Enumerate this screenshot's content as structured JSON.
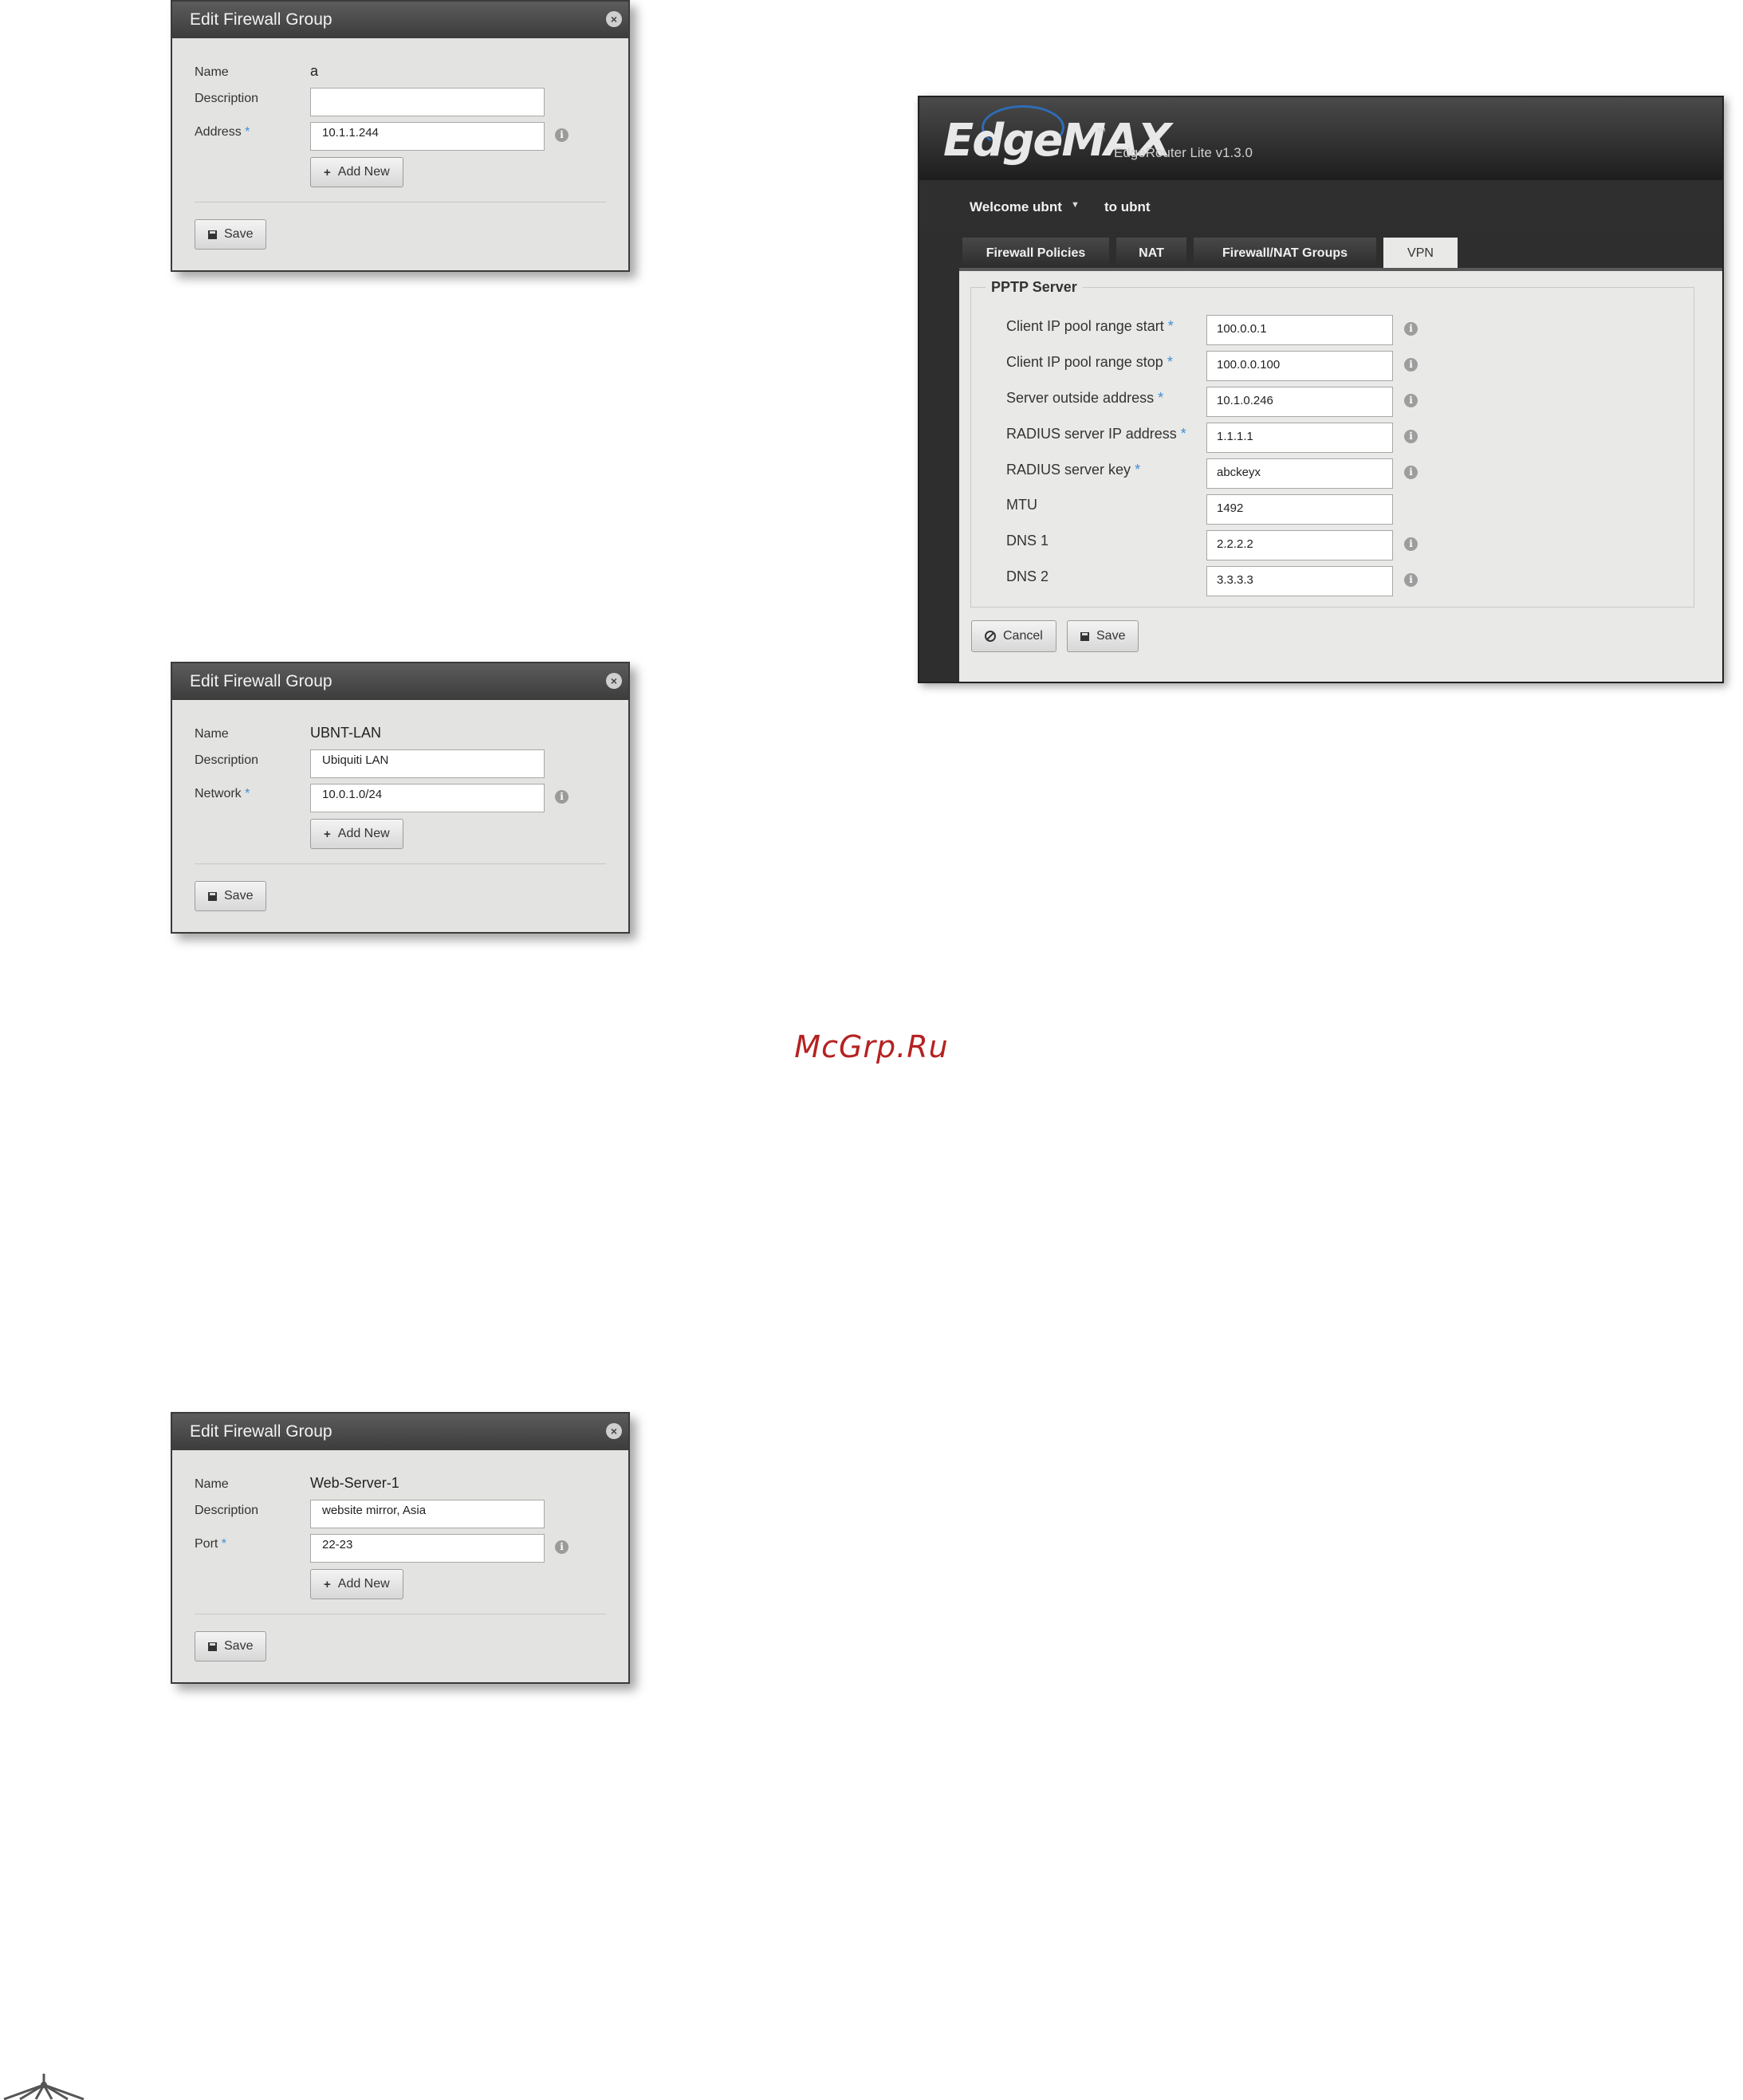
{
  "dialogs": [
    {
      "title": "Edit Firewall Group",
      "name_label": "Name",
      "name_value": "a",
      "description_label": "Description",
      "description_value": "",
      "field_label": "Address",
      "field_value": "10.1.1.244",
      "add_new_label": "Add New",
      "save_label": "Save"
    },
    {
      "title": "Edit Firewall Group",
      "name_label": "Name",
      "name_value": "UBNT-LAN",
      "description_label": "Description",
      "description_value": "Ubiquiti LAN",
      "field_label": "Network",
      "field_value": "10.0.1.0/24",
      "add_new_label": "Add New",
      "save_label": "Save"
    },
    {
      "title": "Edit Firewall Group",
      "name_label": "Name",
      "name_value": "Web-Server-1",
      "description_label": "Description",
      "description_value": "website mirror, Asia",
      "field_label": "Port",
      "field_value": "22-23",
      "add_new_label": "Add New",
      "save_label": "Save"
    }
  ],
  "required_marker": "*",
  "edgemax": {
    "logo": "EdgeMAX",
    "trademark": "™",
    "model": "EdgeRouter Lite v1.3.0",
    "welcome": "Welcome ubnt",
    "to_user": "to ubnt",
    "tabs": [
      "Firewall Policies",
      "NAT",
      "Firewall/NAT Groups",
      "VPN"
    ],
    "active_tab": "VPN",
    "section_title": "PPTP Server",
    "fields": [
      {
        "label": "Client IP pool range start",
        "value": "100.0.0.1"
      },
      {
        "label": "Client IP pool range stop",
        "value": "100.0.0.100"
      },
      {
        "label": "Server outside address",
        "value": "10.1.0.246"
      },
      {
        "label": "RADIUS server IP address",
        "value": "1.1.1.1"
      },
      {
        "label": "RADIUS server key",
        "value": "abckeyx"
      },
      {
        "label": "MTU",
        "value": "1492"
      },
      {
        "label": "DNS 1",
        "value": "2.2.2.2"
      },
      {
        "label": "DNS 2",
        "value": "3.3.3.3"
      }
    ],
    "cancel_label": "Cancel",
    "save_label": "Save"
  },
  "watermark": "McGrp.Ru",
  "colors": {
    "accent_required": "#3d8fd6",
    "dialog_bg": "#e3e3e1",
    "titlebar": "#4a4a4a",
    "watermark": "#b52222"
  }
}
